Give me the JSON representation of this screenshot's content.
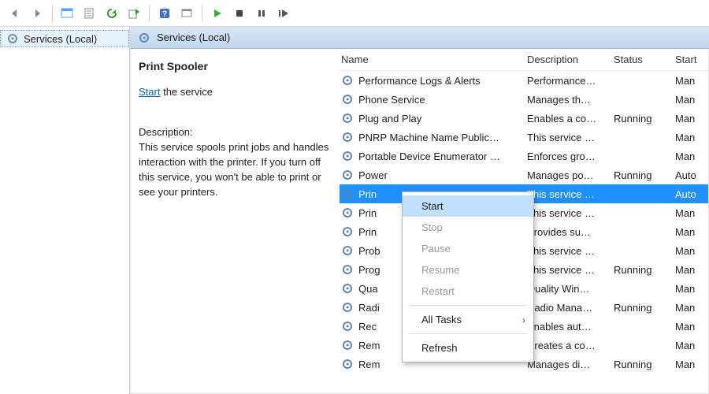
{
  "toolbar": {
    "icons": [
      "back",
      "forward",
      "window-props",
      "props",
      "refresh",
      "export",
      "help",
      "console",
      "play",
      "stop",
      "pause",
      "step"
    ]
  },
  "tree": {
    "root_label": "Services (Local)"
  },
  "header": {
    "title": "Services (Local)"
  },
  "detail": {
    "name": "Print Spooler",
    "start_link": "Start",
    "start_tail": " the service",
    "desc_label": "Description:",
    "desc_text": "This service spools print jobs and handles interaction with the printer. If you turn off this service, you won't be able to print or see your printers."
  },
  "columns": {
    "name": "Name",
    "description": "Description",
    "status": "Status",
    "startup": "Start"
  },
  "rows": [
    {
      "name": "Performance Logs & Alerts",
      "desc": "Performance…",
      "status": "",
      "startup": "Man"
    },
    {
      "name": "Phone Service",
      "desc": "Manages th…",
      "status": "",
      "startup": "Man"
    },
    {
      "name": "Plug and Play",
      "desc": "Enables a co…",
      "status": "Running",
      "startup": "Man"
    },
    {
      "name": "PNRP Machine Name Public…",
      "desc": "This service …",
      "status": "",
      "startup": "Man"
    },
    {
      "name": "Portable Device Enumerator …",
      "desc": "Enforces gro…",
      "status": "",
      "startup": "Man"
    },
    {
      "name": "Power",
      "desc": "Manages po…",
      "status": "Running",
      "startup": "Auto"
    },
    {
      "name": "Prin",
      "desc": "This service …",
      "status": "",
      "startup": "Auto",
      "selected": true
    },
    {
      "name": "Prin",
      "desc": "This service …",
      "status": "",
      "startup": "Man"
    },
    {
      "name": "Prin",
      "desc": "Provides su…",
      "status": "",
      "startup": "Man"
    },
    {
      "name": "Prob",
      "desc": "This service …",
      "status": "",
      "startup": "Man"
    },
    {
      "name": "Prog",
      "desc": "This service …",
      "status": "Running",
      "startup": "Man"
    },
    {
      "name": "Qua",
      "desc": "Quality Win…",
      "status": "",
      "startup": "Man"
    },
    {
      "name": "Radi",
      "desc": "Radio Mana…",
      "status": "Running",
      "startup": "Man"
    },
    {
      "name": "Rec",
      "desc": "Enables aut…",
      "status": "",
      "startup": "Man"
    },
    {
      "name": "Rem",
      "desc": "Creates a co…",
      "status": "",
      "startup": "Man"
    },
    {
      "name": "Rem",
      "desc": "Manages di…",
      "status": "Running",
      "startup": "Man"
    }
  ],
  "context_menu": {
    "items": [
      {
        "label": "Start",
        "enabled": true,
        "highlight": true
      },
      {
        "label": "Stop",
        "enabled": false
      },
      {
        "label": "Pause",
        "enabled": false
      },
      {
        "label": "Resume",
        "enabled": false
      },
      {
        "label": "Restart",
        "enabled": false
      },
      {
        "sep": true
      },
      {
        "label": "All Tasks",
        "enabled": true,
        "submenu": true
      },
      {
        "sep": true
      },
      {
        "label": "Refresh",
        "enabled": true
      }
    ]
  }
}
